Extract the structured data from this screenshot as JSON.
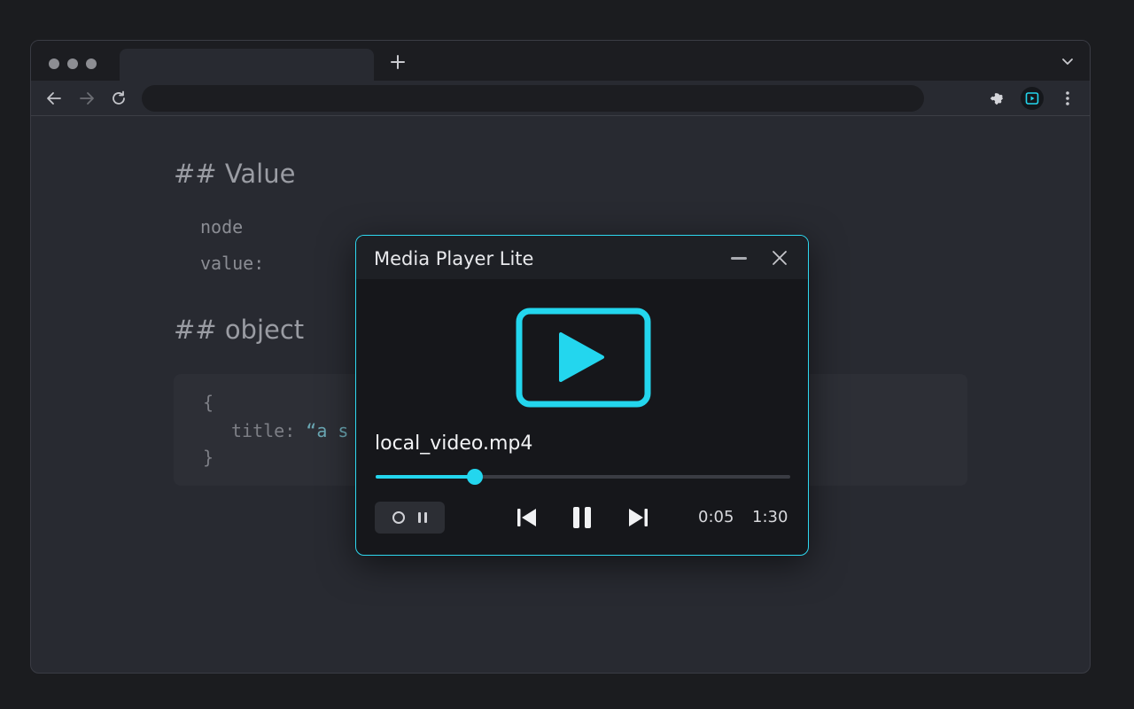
{
  "browser": {
    "tab_title": "",
    "address": ""
  },
  "page": {
    "heading_value": "## Value",
    "line_node": "node",
    "line_value": "value:",
    "heading_object": "## object",
    "code": {
      "open": "{",
      "key": "title: ",
      "string": "“a s",
      "close": "}"
    }
  },
  "player": {
    "title": "Media Player Lite",
    "filename": "local_video.mp4",
    "progress": 0.24,
    "elapsed": "0:05",
    "duration": "1:30",
    "accent": "#23d6ee"
  }
}
